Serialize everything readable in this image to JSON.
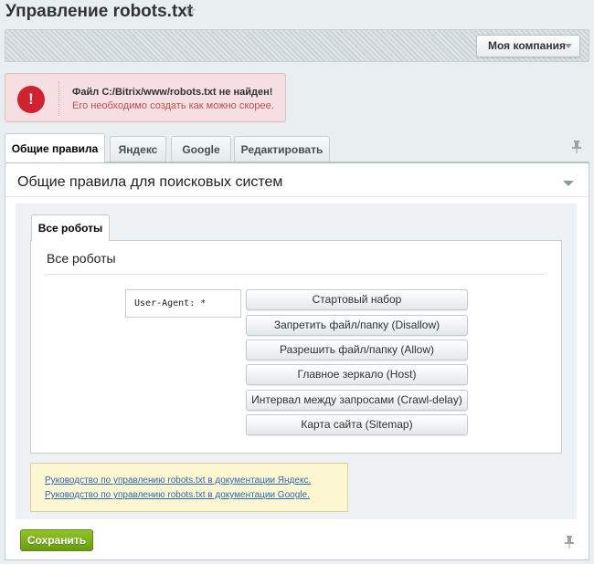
{
  "page": {
    "title": "Управление robots.txt",
    "star_icon": "star-icon"
  },
  "topbar": {
    "company_select": "Моя компания"
  },
  "alert": {
    "title": "Файл C:/Bitrix/www/robots.txt не найден!",
    "text": "Его необходимо создать как можно скорее.",
    "icon": "!"
  },
  "tabs": [
    {
      "label": "Общие правила",
      "active": true
    },
    {
      "label": "Яндекс",
      "active": false
    },
    {
      "label": "Google",
      "active": false
    },
    {
      "label": "Редактировать",
      "active": false
    }
  ],
  "section": {
    "title": "Общие правила для поисковых систем",
    "inner_tab": "Все роботы",
    "inner_title": "Все роботы",
    "user_agent": "User-Agent: *"
  },
  "buttons": [
    "Стартовый набор",
    "Запретить файл/папку (Disallow)",
    "Разрешить файл/папку (Allow)",
    "Главное зеркало (Host)",
    "Интервал между запросами (Crawl-delay)",
    "Карта сайта (Sitemap)"
  ],
  "links": [
    "Руководство по управлению robots.txt в документации Яндекс.",
    "Руководство по управлению robots.txt в документации Google."
  ],
  "save_label": "Сохранить",
  "colors": {
    "alert_icon": "#d1202e",
    "alert_text": "#c0504a",
    "link": "#2b6ab1",
    "save_button": "#7cb01c"
  }
}
